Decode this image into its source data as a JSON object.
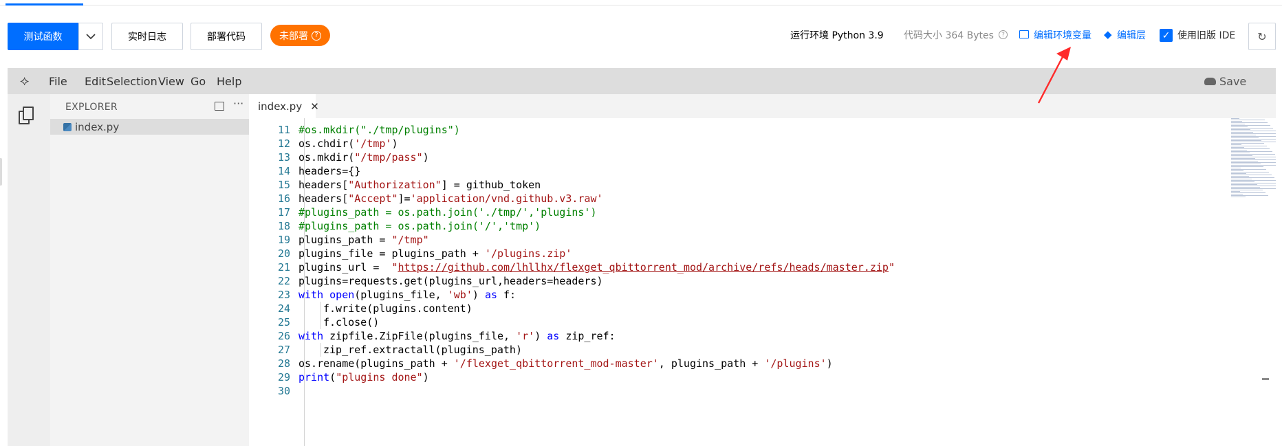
{
  "toolbar": {
    "test_function_label": "测试函数",
    "realtime_log_label": "实时日志",
    "deploy_code_label": "部署代码",
    "undeployed_badge": "未部署",
    "runtime": "运行环境 Python 3.9",
    "code_size": "代码大小 364 Bytes",
    "edit_env_vars_label": "编辑环境变量",
    "edit_layer_label": "编辑层",
    "use_legacy_ide_label": "使用旧版 IDE",
    "use_legacy_ide_checked": true
  },
  "menu": {
    "items": [
      "File",
      "Edit",
      "Selection",
      "View",
      "Go",
      "Help"
    ],
    "save_label": "Save"
  },
  "explorer": {
    "title": "EXPLORER",
    "files": [
      "index.py"
    ]
  },
  "tabs": [
    {
      "label": "index.py",
      "active": true
    }
  ],
  "editor": {
    "lines": [
      {
        "n": "11",
        "indent": 0,
        "tokens": [
          {
            "t": "#os.mkdir(\"./tmp/plugins\")",
            "c": "cm"
          }
        ]
      },
      {
        "n": "12",
        "indent": 0,
        "tokens": [
          {
            "t": "os.chdir(",
            "c": ""
          },
          {
            "t": "'/tmp'",
            "c": "str"
          },
          {
            "t": ")",
            "c": ""
          }
        ]
      },
      {
        "n": "13",
        "indent": 0,
        "tokens": [
          {
            "t": "os.mkdir(",
            "c": ""
          },
          {
            "t": "\"/tmp/pass\"",
            "c": "str"
          },
          {
            "t": ")",
            "c": ""
          }
        ]
      },
      {
        "n": "14",
        "indent": 0,
        "tokens": [
          {
            "t": "headers={}",
            "c": ""
          }
        ]
      },
      {
        "n": "15",
        "indent": 0,
        "tokens": [
          {
            "t": "headers[",
            "c": ""
          },
          {
            "t": "\"Authorization\"",
            "c": "str"
          },
          {
            "t": "] = github_token",
            "c": ""
          }
        ]
      },
      {
        "n": "16",
        "indent": 0,
        "tokens": [
          {
            "t": "headers[",
            "c": ""
          },
          {
            "t": "\"Accept\"",
            "c": "str"
          },
          {
            "t": "]=",
            "c": ""
          },
          {
            "t": "'application/vnd.github.v3.raw'",
            "c": "str"
          }
        ]
      },
      {
        "n": "17",
        "indent": 0,
        "tokens": [
          {
            "t": "#plugins_path = os.path.join('./tmp/','plugins')",
            "c": "cm"
          }
        ]
      },
      {
        "n": "18",
        "indent": 0,
        "tokens": [
          {
            "t": "#plugins_path = os.path.join('/','tmp')",
            "c": "cm"
          }
        ]
      },
      {
        "n": "19",
        "indent": 0,
        "tokens": [
          {
            "t": "plugins_path = ",
            "c": ""
          },
          {
            "t": "\"/tmp\"",
            "c": "str"
          }
        ]
      },
      {
        "n": "20",
        "indent": 0,
        "tokens": [
          {
            "t": "plugins_file = plugins_path + ",
            "c": ""
          },
          {
            "t": "'/plugins.zip'",
            "c": "str"
          }
        ]
      },
      {
        "n": "21",
        "indent": 0,
        "tokens": [
          {
            "t": "plugins_url =  ",
            "c": ""
          },
          {
            "t": "\"",
            "c": "str"
          },
          {
            "t": "https://github.com/lhllhx/flexget_qbittorrent_mod/archive/refs/heads/master.zip",
            "c": "url"
          },
          {
            "t": "\"",
            "c": "str"
          }
        ]
      },
      {
        "n": "22",
        "indent": 0,
        "tokens": [
          {
            "t": "plugins=requests.get(plugins_url,headers=headers)",
            "c": ""
          }
        ]
      },
      {
        "n": "23",
        "indent": 0,
        "tokens": [
          {
            "t": "with",
            "c": "kw"
          },
          {
            "t": " ",
            "c": ""
          },
          {
            "t": "open",
            "c": "kw"
          },
          {
            "t": "(plugins_file, ",
            "c": ""
          },
          {
            "t": "'wb'",
            "c": "str"
          },
          {
            "t": ") ",
            "c": ""
          },
          {
            "t": "as",
            "c": "kw"
          },
          {
            "t": " f:",
            "c": ""
          }
        ]
      },
      {
        "n": "24",
        "indent": 1,
        "tokens": [
          {
            "t": "f.write(plugins.content)",
            "c": ""
          }
        ]
      },
      {
        "n": "25",
        "indent": 1,
        "tokens": [
          {
            "t": "f.close()",
            "c": ""
          }
        ]
      },
      {
        "n": "26",
        "indent": 0,
        "tokens": [
          {
            "t": "with",
            "c": "kw"
          },
          {
            "t": " zipfile.ZipFile(plugins_file, ",
            "c": ""
          },
          {
            "t": "'r'",
            "c": "str"
          },
          {
            "t": ") ",
            "c": ""
          },
          {
            "t": "as",
            "c": "kw"
          },
          {
            "t": " zip_ref:",
            "c": ""
          }
        ]
      },
      {
        "n": "27",
        "indent": 1,
        "tokens": [
          {
            "t": "zip_ref.extractall(plugins_path)",
            "c": ""
          }
        ]
      },
      {
        "n": "28",
        "indent": 0,
        "tokens": [
          {
            "t": "os.rename(plugins_path + ",
            "c": ""
          },
          {
            "t": "'/flexget_qbittorrent_mod-master'",
            "c": "str"
          },
          {
            "t": ", plugins_path + ",
            "c": ""
          },
          {
            "t": "'/plugins'",
            "c": "str"
          },
          {
            "t": ")",
            "c": ""
          }
        ]
      },
      {
        "n": "29",
        "indent": 0,
        "tokens": [
          {
            "t": "print",
            "c": "kw"
          },
          {
            "t": "(",
            "c": ""
          },
          {
            "t": "\"plugins done\"",
            "c": "str"
          },
          {
            "t": ")",
            "c": ""
          }
        ]
      },
      {
        "n": "30",
        "indent": 0,
        "tokens": []
      }
    ]
  },
  "colors": {
    "accent": "#006eff",
    "badge": "#ff7200",
    "annotation_arrow": "#ff2a2a"
  }
}
